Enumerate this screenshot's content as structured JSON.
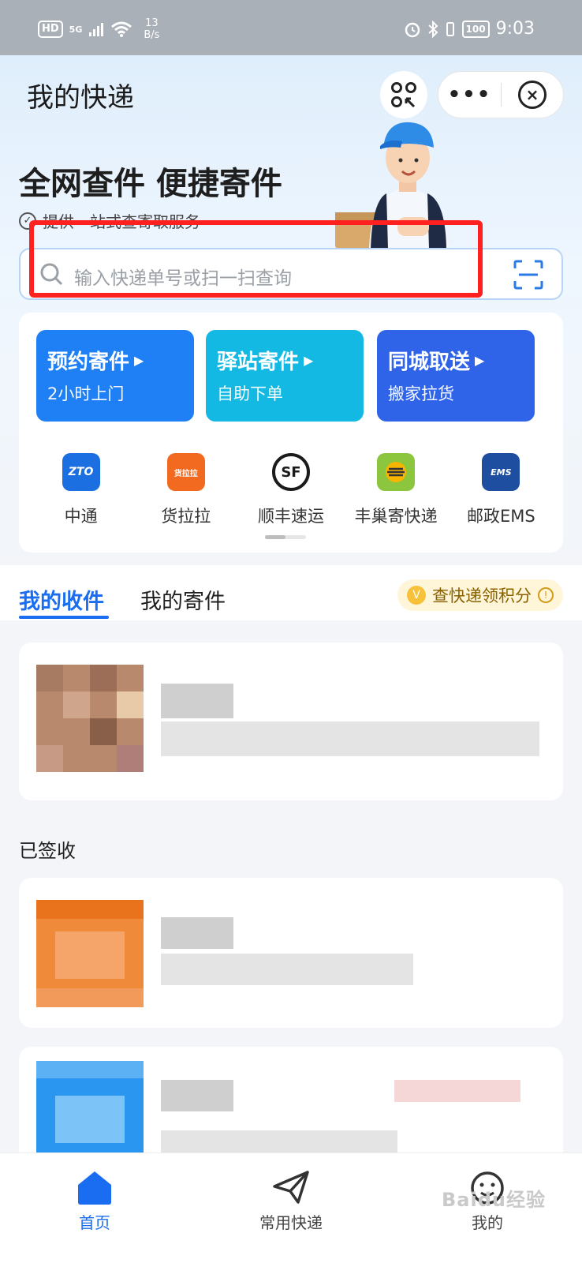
{
  "status_bar": {
    "hd": "HD",
    "signal": "5G",
    "net_speed_value": "13",
    "net_speed_unit": "B/s",
    "battery": "100",
    "time": "9:03"
  },
  "header": {
    "title": "我的快递",
    "more_label": "•••",
    "close_label": "×"
  },
  "hero": {
    "headline": "全网查件 便捷寄件",
    "subline": "提供一站式查寄取服务"
  },
  "search": {
    "placeholder": "输入快递单号或扫一扫查询"
  },
  "services": [
    {
      "title": "预约寄件",
      "subtitle": "2小时上门",
      "color": "#1f7ff5"
    },
    {
      "title": "驿站寄件",
      "subtitle": "自助下单",
      "color": "#13b9e2"
    },
    {
      "title": "同城取送",
      "subtitle": "搬家拉货",
      "color": "#2f63e8"
    }
  ],
  "couriers": [
    {
      "name": "中通",
      "icon": "zto-logo-icon",
      "logo_text": "ZTO",
      "color": "#1c6fe0"
    },
    {
      "name": "货拉拉",
      "icon": "huolala-logo-icon",
      "logo_text": "货拉拉",
      "color": "#f26a1f"
    },
    {
      "name": "顺丰速运",
      "icon": "sf-logo-icon",
      "logo_text": "SF",
      "color": "#1b1b1b"
    },
    {
      "name": "丰巢寄快递",
      "icon": "fengchao-logo-icon",
      "logo_text": "",
      "color": "#8cc63f"
    },
    {
      "name": "邮政EMS",
      "icon": "ems-logo-icon",
      "logo_text": "EMS",
      "color": "#1d4e9f"
    }
  ],
  "tabs": {
    "received": "我的收件",
    "sent": "我的寄件",
    "points": "查快递领积分",
    "points_coin": "V",
    "points_info": "!"
  },
  "sections": {
    "signed": "已签收"
  },
  "bottom_nav": {
    "home": "首页",
    "common": "常用快递",
    "mine": "我的"
  },
  "watermark": "Baidu经验"
}
